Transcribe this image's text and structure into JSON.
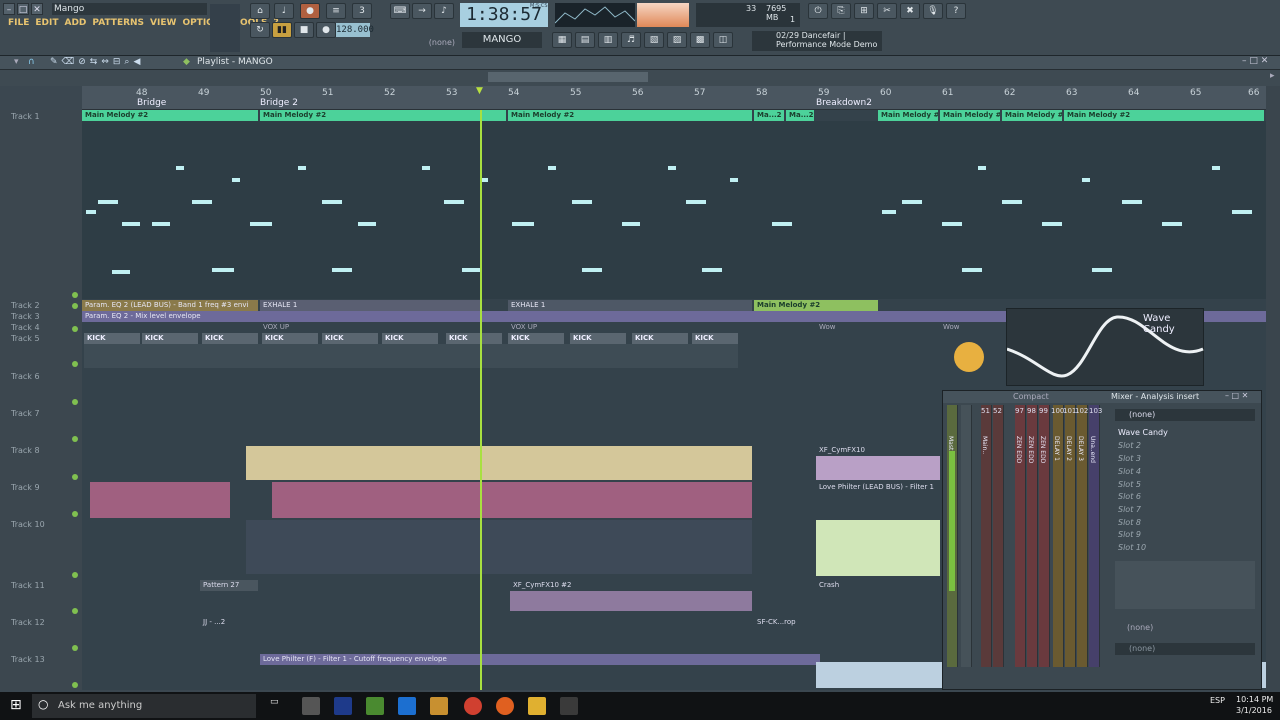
{
  "window": {
    "title": "Mango"
  },
  "menu": [
    "FILE",
    "EDIT",
    "ADD",
    "PATTERNS",
    "VIEW",
    "OPTIONS",
    "TOOLS",
    "?"
  ],
  "transport": {
    "time": "1:38:57",
    "time_unit": "M:S:CS",
    "tempo": "128.000",
    "pattern": "MANGO",
    "pattern_none": "(none)",
    "cpu": "33",
    "memory": "7695 MB",
    "voices": "1"
  },
  "hint": {
    "line1": "02/29  Dancefair |",
    "line2": "Performance Mode Demo"
  },
  "playlist": {
    "title": "Playlist - MANGO"
  },
  "ruler": {
    "bars": [
      "48",
      "49",
      "50",
      "51",
      "52",
      "53",
      "54",
      "55",
      "56",
      "57",
      "58",
      "59",
      "60",
      "61",
      "62",
      "63",
      "64",
      "65",
      "66"
    ],
    "markers": [
      "Bridge",
      "Bridge 2",
      "Breakdown2"
    ]
  },
  "tracks": [
    "Track 1",
    "Track 2",
    "Track 3",
    "Track 4",
    "Track 5",
    "Track 6",
    "Track 7",
    "Track 8",
    "Track 9",
    "Track 10",
    "Track 11",
    "Track 12",
    "Track 13"
  ],
  "clips": {
    "melody": "Main Melody #2",
    "melody_short": "Ma...2",
    "param": "Param. EQ 2 (LEAD BUS) - Band 1 freq #3 envi",
    "exhale": "EXHALE 1",
    "param2": "Param. EQ 2 - Mix level envelope",
    "voxup": "VOX UP",
    "wow": "Wow",
    "kick": "KICK",
    "cymfx": "XF_CymFX10",
    "cymfx2": "XF_CymFX10 #2",
    "love": "Love Philter (LEAD BUS) - Filter 1",
    "pattern27": "Pattern 27",
    "crash": "Crash",
    "jj": "JJ - ...2",
    "sfck": "SF-CK...rop",
    "lovefilter": "Love Philter (F) - Filter 1 - Cutoff frequency envelope"
  },
  "wavecandy": {
    "label": "Wave Candy"
  },
  "mixer": {
    "title": "Mixer - Analysis insert",
    "mode": "Compact",
    "preset": "(none)",
    "insert_none": "(none)",
    "slots": [
      "Wave Candy",
      "Slot 2",
      "Slot 3",
      "Slot 4",
      "Slot 5",
      "Slot 6",
      "Slot 7",
      "Slot 8",
      "Slot 9",
      "Slot 10"
    ],
    "channels": [
      "51",
      "52",
      "97",
      "98",
      "99",
      "100",
      "101",
      "102",
      "103"
    ],
    "ch_labels": [
      "Mast..der",
      "Main..",
      "ZEN EDD",
      "ZEN EDD",
      "ZEN EDD",
      "DELAY 1",
      "DELAY 2",
      "DELAY 3",
      "Una..end"
    ]
  },
  "taskbar": {
    "search": "Ask me anything",
    "time": "10:14 PM",
    "date": "3/1/2016",
    "lang": "ESP"
  }
}
